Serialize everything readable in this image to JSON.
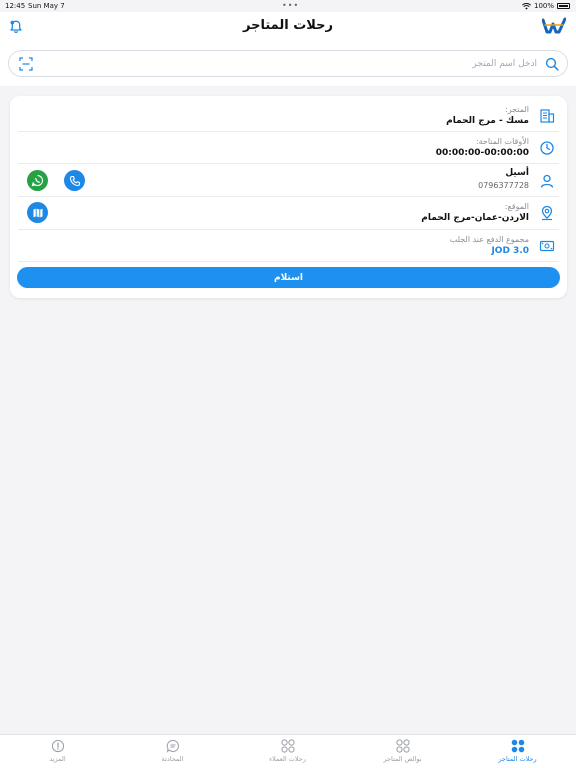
{
  "status_bar": {
    "time": "12:45",
    "date": "Sun May 7",
    "battery": "100%"
  },
  "header": {
    "title": "رحلات المتاجر"
  },
  "search": {
    "placeholder": "ادخل اسم المتجر"
  },
  "card": {
    "store": {
      "label": "المتجر:",
      "value": "مسك - مرج الحمام"
    },
    "times": {
      "label": "الأوقات المتاحة:",
      "value": "00:00:00-00:00:00"
    },
    "contact": {
      "name": "أسيل",
      "phone": "0796377728"
    },
    "location": {
      "label": "الموقع:",
      "value": "الاردن-عمان-مرج الحمام"
    },
    "payment": {
      "label": "مجموع الدفع عند الجلب",
      "amount": "JOD 3.0"
    },
    "receive_label": "استلام"
  },
  "tabs": [
    {
      "label": "رحلات المتاجر",
      "icon": "grid-dots-icon",
      "active": true
    },
    {
      "label": "بوالص المتاجر",
      "icon": "grid-circles-icon",
      "active": false
    },
    {
      "label": "رحلات العملاء",
      "icon": "grid-circles-icon",
      "active": false
    },
    {
      "label": "المحادثة",
      "icon": "chat-icon",
      "active": false
    },
    {
      "label": "المزيد",
      "icon": "info-icon",
      "active": false
    }
  ],
  "colors": {
    "accent": "#1e88e5",
    "whatsapp": "#25a244",
    "background": "#f4f4f6"
  }
}
